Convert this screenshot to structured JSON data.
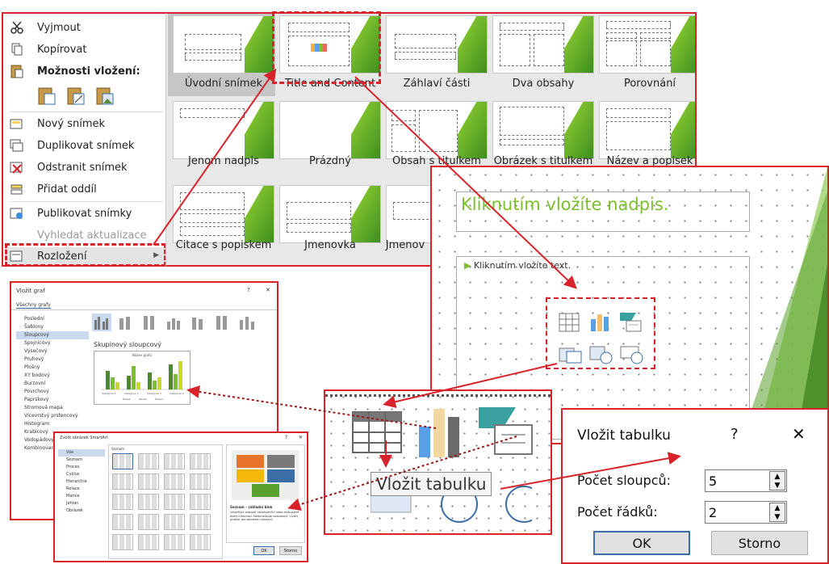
{
  "context_menu": {
    "items": [
      {
        "label": "Vyjmout",
        "icon": "scissors-icon"
      },
      {
        "label": "Kopírovat",
        "icon": "copy-icon"
      },
      {
        "label": "Možnosti vložení:",
        "icon": "paste-icon"
      },
      {
        "label": "Nový snímek",
        "icon": "new-slide-icon"
      },
      {
        "label": "Duplikovat snímek",
        "icon": "duplicate-slide-icon"
      },
      {
        "label": "Odstranit snímek",
        "icon": "delete-slide-icon"
      },
      {
        "label": "Přidat oddíl",
        "icon": "add-section-icon"
      },
      {
        "label": "Publikovat snímky",
        "icon": "publish-icon"
      },
      {
        "label": "Vyhledat aktualizace",
        "icon": ""
      },
      {
        "label": "Rozložení",
        "icon": "layout-icon"
      }
    ]
  },
  "layout_gallery": {
    "items": [
      "Úvodní snímek",
      "Title and Content",
      "Záhlaví části",
      "Dva obsahy",
      "Porovnání",
      "Jenom nadpis",
      "Prázdný",
      "Obsah s titulkem",
      "Obrázek s titulkem",
      "Název a popisek",
      "Citace s popiskem",
      "Jmenovka",
      "Jmenov"
    ]
  },
  "slide": {
    "title_placeholder": "Kliknutím vložíte nadpis.",
    "text_placeholder": "Kliknutím vložíte text.",
    "accent_color": "#7cbf2e"
  },
  "insert_chart_dialog": {
    "title": "Vložit graf",
    "tab": "Všechny grafy",
    "categories": [
      "Poslední",
      "Šablony",
      "Sloupcový",
      "Spojnicový",
      "Výsečový",
      "Pruhový",
      "Plošný",
      "XY bodový",
      "Burzovní",
      "Povrchový",
      "Paprskový",
      "Stromová mapa",
      "Vícevrstvý prstencový",
      "Histogram",
      "Krabicový",
      "Vodopádový",
      "Kombinovaný"
    ],
    "selected_category": "Sloupcový",
    "chart_subtype": "Skupinový sloupcový",
    "preview_title": "Název grafu",
    "preview_categories": [
      "Kategorie 1",
      "Kategorie 2",
      "Kategorie 3",
      "Kategorie 4"
    ],
    "preview_legend": [
      "Řada1",
      "Řada2",
      "Řada3"
    ]
  },
  "smartart_dialog": {
    "title": "Zvolit obrázek SmartArt",
    "categories": [
      "Vše",
      "Seznam",
      "Proces",
      "Cyklus",
      "Hierarchie",
      "Relace",
      "Matice",
      "Jehlan",
      "Obrázek"
    ],
    "selected": "Vše",
    "gallery_header": "Seznam",
    "desc_title": "Seznam – základní blok",
    "desc_text": "Umožňuje zobrazit nesekvenční nebo seskupené bloky informací. Maximalizuje vodorovný i svislý prostor pro zobrazení obrazců.",
    "ok": "OK",
    "cancel": "Storno"
  },
  "zoom": {
    "tooltip": "Vložit tabulku"
  },
  "insert_table_dialog": {
    "title": "Vložit tabulku",
    "help": "?",
    "close": "✕",
    "columns_label": "Počet sloupců:",
    "columns_value": "5",
    "rows_label": "Počet řádků:",
    "rows_value": "2",
    "ok": "OK",
    "cancel": "Storno"
  }
}
